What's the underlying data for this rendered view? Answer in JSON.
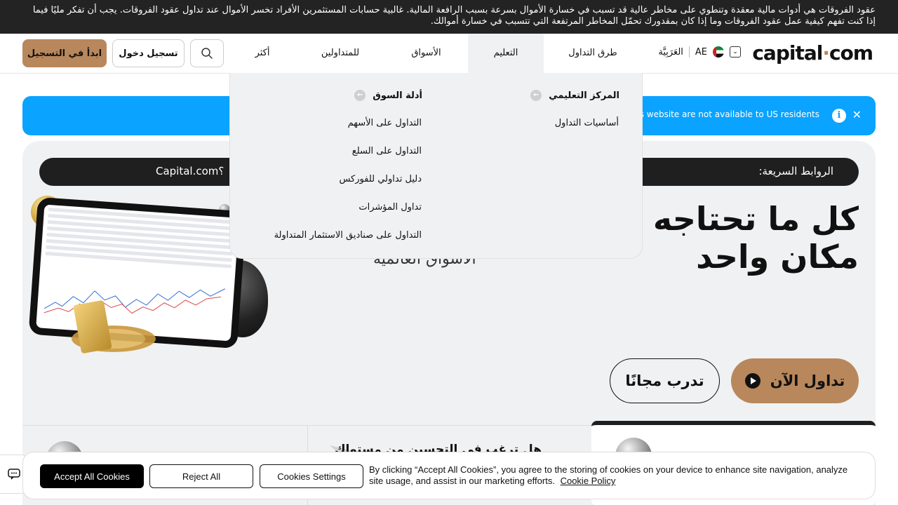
{
  "risk_warning": "عقود الفروقات هي أدوات مالية معقدة وتنطوي على مخاطر عالية قد تسبب في خسارة الأموال بسرعة بسبب الرافعة المالية. غالبية حسابات المستثمرين الأفراد تخسر الأموال عند تداول عقود الفروقات. يجب أن تفكر مليًا فيما إذا كنت تفهم كيفية عمل عقود الفروقات وما إذا كان بمقدورك تحمّل المخاطر المرتفعة التي تتسبب في خسارة أموالك.",
  "header": {
    "logo_main": "capital",
    "logo_dot": "·",
    "logo_end": "com",
    "region": "AE",
    "language": "العَرَبِيَّة",
    "nav": {
      "ways": "طرق التداول",
      "education": "التعليم",
      "markets": "الأسواق",
      "traders": "للمتداولين",
      "more": "أكثر"
    },
    "login": "تسجيل دخول",
    "signup": "ابدأ في التسجيل"
  },
  "dropdown": {
    "col1_title": "المركز التعليمي",
    "col1_links": [
      "أساسيات التداول"
    ],
    "col2_title": "أدلة السوق",
    "col2_links": [
      "التداول على الأسهم",
      "التداول على السلع",
      "دليل تداولي للفوركس",
      "تداول المؤشرات",
      "التداول على صناديق الاستثمار المتداولة"
    ]
  },
  "notice": {
    "text": "s website are not available to US residents"
  },
  "hero": {
    "quick_links_label": "الروابط السريعة:",
    "quick_link_left": "Capital.com؟",
    "title_line1": "كل ما تحتاجه مو",
    "title_line2": "مكان واحد",
    "subtitle": "الأسواق العالمية",
    "trade_now": "تداول الآن",
    "practice": "تدرب مجانًا",
    "card_text": "هل ترغب في التحسين من مستواك"
  },
  "cookie": {
    "accept": "Accept All Cookies",
    "reject": "Reject All",
    "settings": "Cookies Settings",
    "text": "By clicking “Accept All Cookies”, you agree to the storing of cookies on your device to enhance site navigation, analyze site usage, and assist in our marketing efforts.",
    "policy": "Cookie Policy"
  },
  "colors": {
    "brand_gold": "#b8875c",
    "notice_blue": "#0aa3ff",
    "dark": "#1f1f1f"
  }
}
